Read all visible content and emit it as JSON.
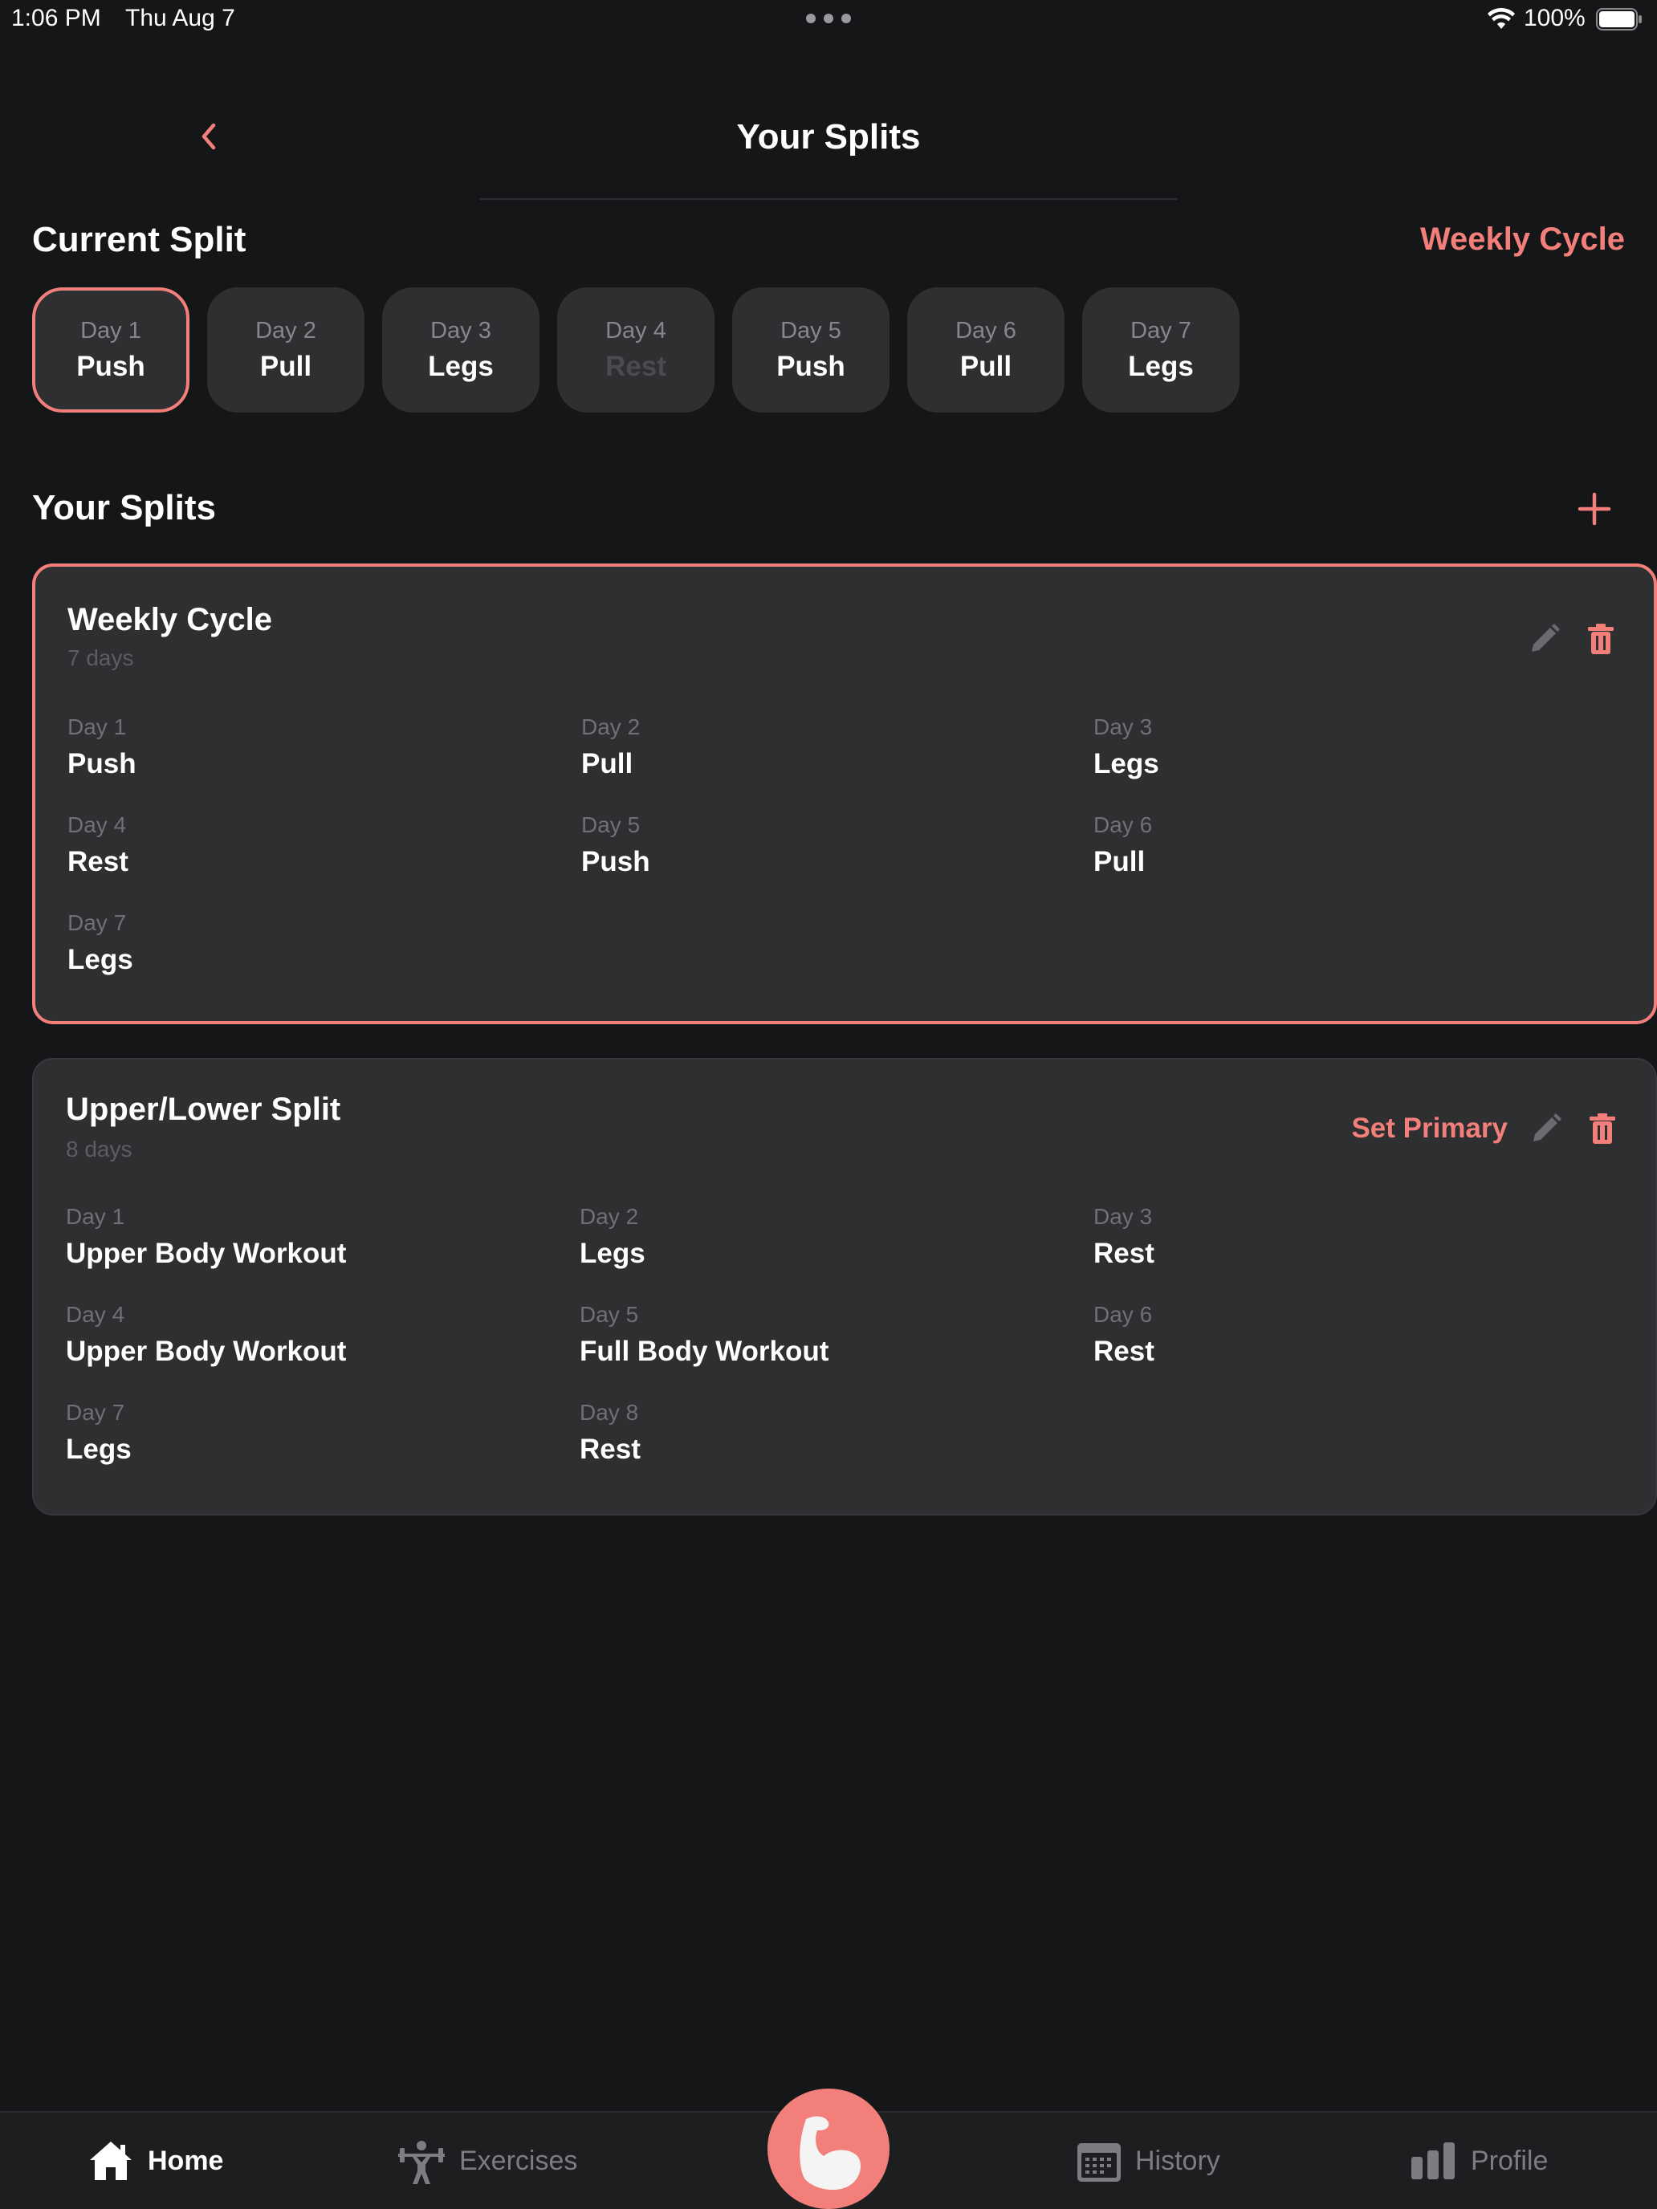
{
  "status_bar": {
    "time": "1:06 PM",
    "date": "Thu Aug 7",
    "battery": "100%"
  },
  "header": {
    "title": "Your Splits"
  },
  "current_split": {
    "heading": "Current Split",
    "name": "Weekly Cycle",
    "days": [
      {
        "day": "Day 1",
        "name": "Push",
        "active": true
      },
      {
        "day": "Day 2",
        "name": "Pull"
      },
      {
        "day": "Day 3",
        "name": "Legs"
      },
      {
        "day": "Day 4",
        "name": "Rest",
        "rest": true
      },
      {
        "day": "Day 5",
        "name": "Push"
      },
      {
        "day": "Day 6",
        "name": "Pull"
      },
      {
        "day": "Day 7",
        "name": "Legs"
      }
    ]
  },
  "splits_section": {
    "heading": "Your Splits"
  },
  "splits": [
    {
      "title": "Weekly Cycle",
      "subtitle": "7 days",
      "primary": true,
      "days": [
        {
          "day": "Day 1",
          "name": "Push"
        },
        {
          "day": "Day 2",
          "name": "Pull"
        },
        {
          "day": "Day 3",
          "name": "Legs"
        },
        {
          "day": "Day 4",
          "name": "Rest"
        },
        {
          "day": "Day 5",
          "name": "Push"
        },
        {
          "day": "Day 6",
          "name": "Pull"
        },
        {
          "day": "Day 7",
          "name": "Legs"
        }
      ]
    },
    {
      "title": "Upper/Lower Split",
      "subtitle": "8 days",
      "set_primary_label": "Set Primary",
      "days": [
        {
          "day": "Day 1",
          "name": "Upper Body Workout"
        },
        {
          "day": "Day 2",
          "name": "Legs"
        },
        {
          "day": "Day 3",
          "name": "Rest"
        },
        {
          "day": "Day 4",
          "name": "Upper Body Workout"
        },
        {
          "day": "Day 5",
          "name": "Full Body Workout"
        },
        {
          "day": "Day 6",
          "name": "Rest"
        },
        {
          "day": "Day 7",
          "name": "Legs"
        },
        {
          "day": "Day 8",
          "name": "Rest"
        }
      ]
    }
  ],
  "tab_bar": {
    "home": "Home",
    "exercises": "Exercises",
    "history": "History",
    "profile": "Profile",
    "center_icon": "flexed-arm-icon"
  },
  "colors": {
    "accent": "#f27f7a",
    "background": "#151618",
    "card": "#2e2f31"
  }
}
